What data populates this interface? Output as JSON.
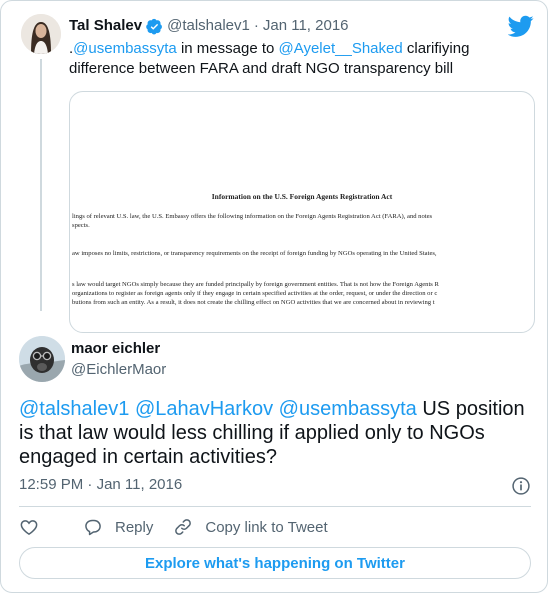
{
  "parent": {
    "name": "Tal Shalev",
    "handle": "@talshalev1",
    "separator": "·",
    "date": "Jan 11, 2016",
    "text_prefix": ".",
    "mention1": "@usembassyta",
    "text_mid1": " in message to ",
    "mention2": "@Ayelet__Shaked",
    "text_mid2": " clarifiying difference between FARA and draft NGO transparency bill"
  },
  "document": {
    "title": "Information on the U.S. Foreign Agents Registration Act",
    "lines": [
      "lings of relevant U.S. law, the U.S. Embassy offers the following information on the Foreign Agents Registration Act (FARA), and notes",
      "spects.",
      "aw imposes no limits, restrictions, or transparency requirements on the receipt of foreign funding by NGOs operating in the United States,",
      "s law would target NGOs simply because they are funded principally by foreign government entities. That is not how the Foreign Agents R",
      "organizations to register as foreign agents only if they engage in certain specified activities at the order, request, or under the direction or c",
      "butions from such an entity.  As a result, it does not create the chilling effect on NGO activities that we are concerned about in reviewing t"
    ]
  },
  "reply": {
    "name": "maor eichler",
    "handle": "@EichlerMaor",
    "mention1": "@talshalev1",
    "mention2": "@LahavHarkov",
    "mention3": "@usembassyta",
    "text": " US position is that law would less chilling if applied only to NGOs engaged in certain activities?",
    "time": "12:59 PM",
    "separator": "·",
    "date": "Jan 11, 2016"
  },
  "actions": {
    "reply_label": "Reply",
    "copy_label": "Copy link to Tweet"
  },
  "explore_label": "Explore what's happening on Twitter",
  "colors": {
    "link": "#1d9bf0",
    "text": "#0f1419",
    "muted": "#536471",
    "border": "#cfd9de"
  }
}
